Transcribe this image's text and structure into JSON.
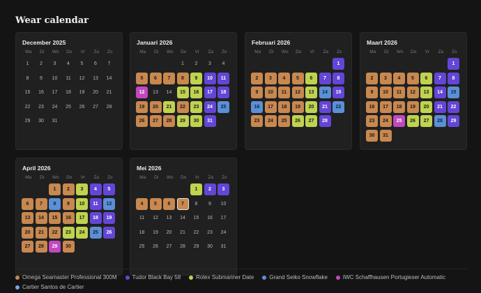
{
  "title": "Wear calendar",
  "weekday_labels": [
    "Ma",
    "Di",
    "Wo",
    "Do",
    "Vr",
    "Za",
    "Zo"
  ],
  "watches": [
    {
      "id": 1,
      "name": "Omega Seamaster Professional 300M",
      "color": "#c8884f"
    },
    {
      "id": 2,
      "name": "Tudor Black Bay 58",
      "color": "#6446d6"
    },
    {
      "id": 3,
      "name": "Rolex Submariner Date",
      "color": "#bfd34f"
    },
    {
      "id": 4,
      "name": "Grand Seiko Snowflake",
      "color": "#5b8fd6"
    },
    {
      "id": 5,
      "name": "IWC Schaffhausen Portugieser Automatic",
      "color": "#c248c0"
    },
    {
      "id": 6,
      "name": "Cartier Santos de Cartier",
      "color": "#7aa3e6"
    }
  ],
  "months": [
    {
      "name": "December 2025",
      "first_weekday": 0,
      "days_in_month": 31,
      "wear": {}
    },
    {
      "name": "Januari 2026",
      "first_weekday": 3,
      "days_in_month": 31,
      "wear": {
        "5": 1,
        "6": 1,
        "7": 1,
        "8": 1,
        "9": 3,
        "10": 2,
        "11": 2,
        "12": 5,
        "15": 3,
        "16": 3,
        "17": 2,
        "18": 2,
        "19": 1,
        "20": 1,
        "21": 3,
        "22": 1,
        "23": 3,
        "24": 2,
        "25": 4,
        "26": 1,
        "27": 1,
        "28": 1,
        "29": 3,
        "30": 3,
        "31": 2
      }
    },
    {
      "name": "Februari 2026",
      "first_weekday": 6,
      "days_in_month": 28,
      "wear": {
        "1": 2,
        "2": 1,
        "3": 1,
        "4": 1,
        "5": 1,
        "6": 3,
        "7": 2,
        "8": 2,
        "9": 1,
        "10": 1,
        "11": 1,
        "12": 1,
        "13": 3,
        "14": 4,
        "15": 2,
        "16": 4,
        "17": 1,
        "18": 1,
        "19": 1,
        "20": 3,
        "21": 2,
        "22": 4,
        "23": 1,
        "24": 1,
        "25": 1,
        "26": 3,
        "27": 3,
        "28": 2
      }
    },
    {
      "name": "Maart 2026",
      "first_weekday": 6,
      "days_in_month": 31,
      "wear": {
        "1": 2,
        "2": 1,
        "3": 1,
        "4": 1,
        "5": 1,
        "6": 3,
        "7": 2,
        "8": 2,
        "9": 1,
        "10": 1,
        "11": 1,
        "12": 1,
        "13": 3,
        "14": 2,
        "15": 4,
        "16": 1,
        "17": 1,
        "18": 1,
        "19": 1,
        "20": 3,
        "21": 2,
        "22": 2,
        "23": 1,
        "24": 1,
        "25": 5,
        "26": 3,
        "27": 3,
        "28": 4,
        "29": 2,
        "30": 1,
        "31": 1
      }
    },
    {
      "name": "April 2026",
      "first_weekday": 2,
      "days_in_month": 30,
      "wear": {
        "1": 1,
        "2": 1,
        "3": 3,
        "4": 2,
        "5": 2,
        "6": 1,
        "7": 1,
        "8": 4,
        "9": 1,
        "10": 3,
        "11": 2,
        "12": 4,
        "13": 1,
        "14": 1,
        "15": 1,
        "16": 1,
        "17": 3,
        "18": 2,
        "19": 2,
        "20": 1,
        "21": 1,
        "22": 1,
        "23": 3,
        "24": 3,
        "25": 4,
        "26": 2,
        "27": 1,
        "28": 1,
        "29": 5,
        "30": 1
      }
    },
    {
      "name": "Mei 2026",
      "first_weekday": 4,
      "days_in_month": 31,
      "today": 7,
      "wear": {
        "1": 3,
        "2": 2,
        "3": 2,
        "4": 1,
        "5": 1,
        "6": 1,
        "7": 1
      }
    }
  ]
}
